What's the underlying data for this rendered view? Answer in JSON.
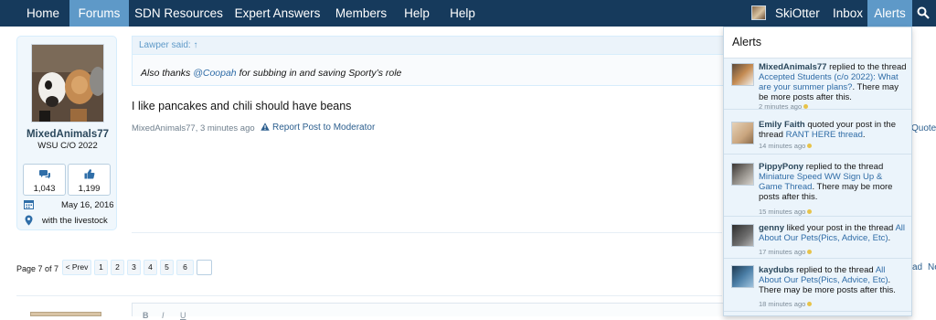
{
  "nav": {
    "tabs": [
      "Home",
      "Forums",
      "SDN Resources",
      "Expert Answers",
      "Members",
      "Help",
      "Help"
    ],
    "active_tab": "Forums",
    "username": "SkiOtter",
    "inbox": "Inbox",
    "alerts": "Alerts",
    "colors": {
      "bar": "#163a5c",
      "active": "#5e99c8"
    }
  },
  "post": {
    "author": "MixedAnimals77",
    "user_title": "WSU C/O 2022",
    "stats": {
      "messages": "1,043",
      "likes": "1,199"
    },
    "join_date": "May 16, 2016",
    "location": "with the livestock",
    "quote_header": "Lawper said: ↑",
    "quote_prefix": "Also thanks ",
    "quote_mention": "@Coopah",
    "quote_suffix": " for subbing in and saving Sporty’s role",
    "message": "I like pancakes and chili should have beans",
    "meta": "MixedAnimals77, 3 minutes ago",
    "report": "Report Post to Moderator",
    "quote_link": "Quote"
  },
  "pagination": {
    "label": "Page 7 of 7",
    "prev": "< Prev",
    "pages": [
      "1",
      "2",
      "3",
      "4",
      "5",
      "6"
    ],
    "tail_a": "ad",
    "tail_b": "Ne"
  },
  "editor": {
    "glyphs": [
      "B",
      "I",
      "U"
    ]
  },
  "alerts_popup": {
    "title": "Alerts",
    "items": [
      {
        "user": "MixedAnimals77",
        "pre": " replied to the thread ",
        "link": "Accepted Students (c/o 2022): What are your summer plans?",
        "post": ". There may be more posts after this.",
        "time": "2 minutes ago"
      },
      {
        "user": "Emily Faith",
        "pre": " quoted your post in the thread ",
        "link": "RANT HERE thread",
        "post": ".",
        "time": "14 minutes ago"
      },
      {
        "user": "PippyPony",
        "pre": " replied to the thread ",
        "link": "Miniature Speed WW Sign Up & Game Thread",
        "post": ". There may be more posts after this.",
        "time": "15 minutes ago"
      },
      {
        "user": "genny",
        "pre": " liked your post in the thread ",
        "link": "All About Our Pets(Pics, Advice, Etc)",
        "post": ".",
        "time": "17 minutes ago"
      },
      {
        "user": "kaydubs",
        "pre": " replied to the thread ",
        "link": "All About Our Pets(Pics, Advice, Etc)",
        "post": ". There may be more posts after this.",
        "time": "18 minutes ago"
      }
    ]
  }
}
